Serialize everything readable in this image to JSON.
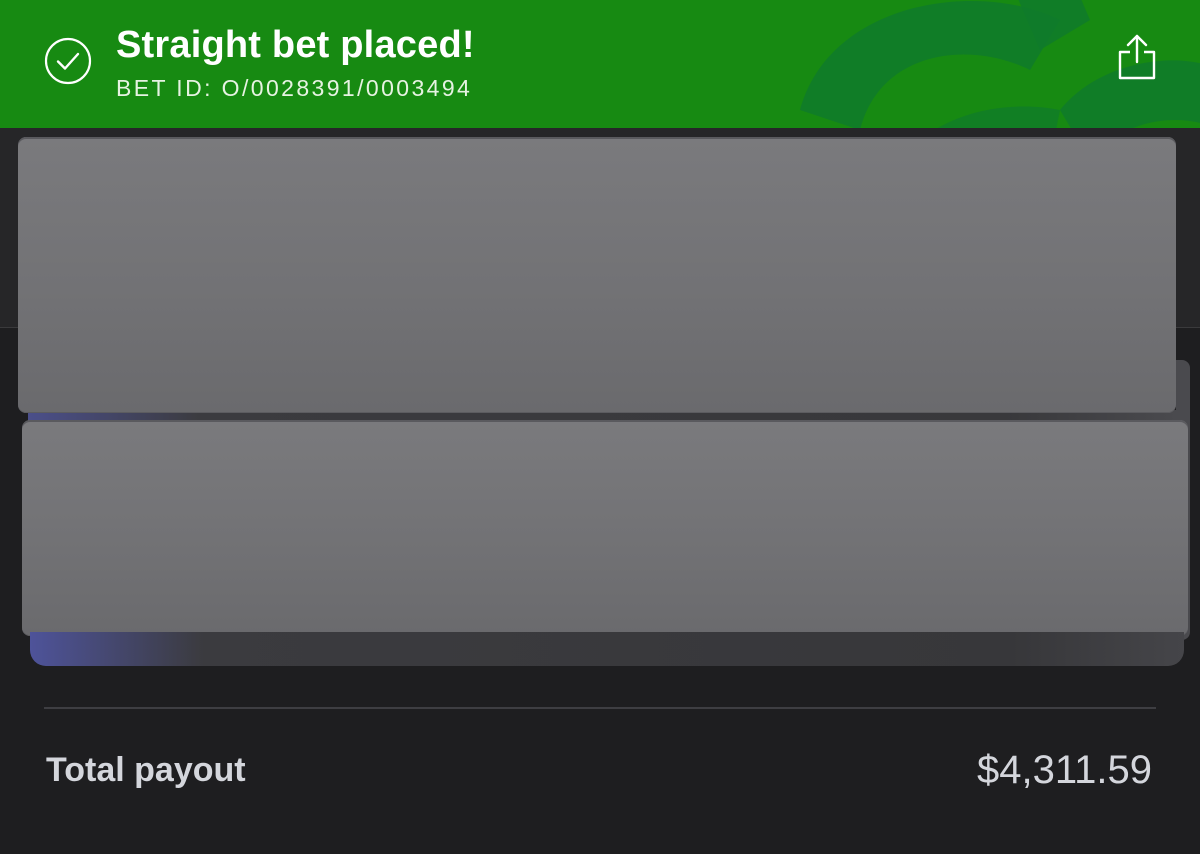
{
  "banner": {
    "title": "Straight bet placed!",
    "bet_id": "BET ID: O/0028391/0003494",
    "color": "#178a12",
    "status_icon": "check-circle-icon",
    "share_icon": "share-icon"
  },
  "summary": {
    "total_payout_label": "Total payout",
    "total_payout_value": "$4,311.59"
  },
  "colors": {
    "background": "#1e1e20",
    "text": "#d4d6dc",
    "redaction": "#737376"
  }
}
